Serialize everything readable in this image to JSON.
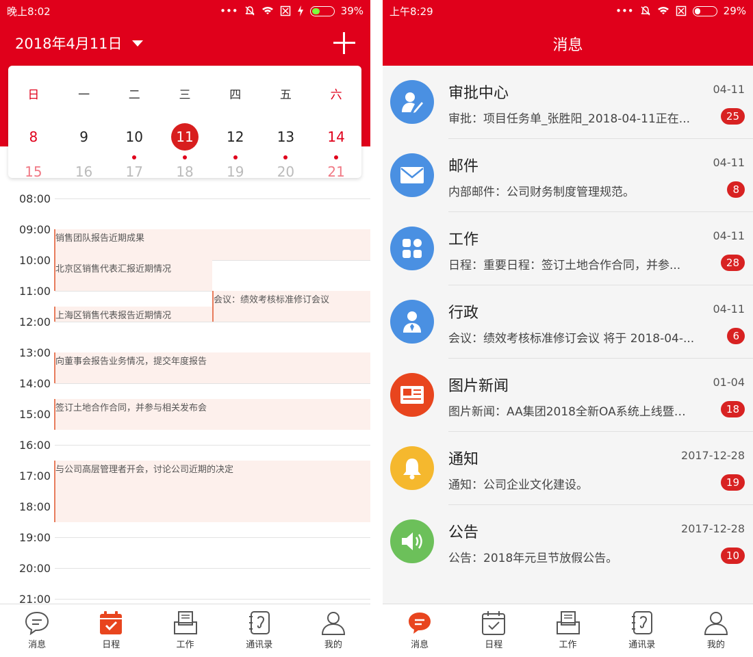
{
  "left": {
    "status": {
      "time": "晚上8:02",
      "battery": "39%",
      "battery_level": 0.39
    },
    "header": {
      "date": "2018年4月11日"
    },
    "weekdays": [
      "日",
      "一",
      "二",
      "三",
      "四",
      "五",
      "六"
    ],
    "dates": [
      "8",
      "9",
      "10",
      "11",
      "12",
      "13",
      "14"
    ],
    "next_dates": [
      "15",
      "16",
      "17",
      "18",
      "19",
      "20",
      "21"
    ],
    "selected_date": "11",
    "hours": [
      "08:00",
      "09:00",
      "10:00",
      "11:00",
      "12:00",
      "13:00",
      "14:00",
      "15:00",
      "16:00",
      "17:00",
      "18:00",
      "19:00",
      "20:00",
      "21:00"
    ],
    "events": [
      {
        "title": "销售团队报告近期成果",
        "start": "09:00",
        "end": "10:00",
        "column": "full"
      },
      {
        "title": "北京区销售代表汇报近期情况",
        "start": "10:00",
        "end": "11:00",
        "column": "left"
      },
      {
        "title": "会议：绩效考核标准修订会议",
        "start": "11:00",
        "end": "12:00",
        "column": "right"
      },
      {
        "title": "上海区销售代表报告近期情况",
        "start": "11:30",
        "end": "12:00",
        "column": "left"
      },
      {
        "title": "向董事会报告业务情况，提交年度报告",
        "start": "13:00",
        "end": "14:00",
        "column": "full"
      },
      {
        "title": "签订土地合作合同，并参与相关发布会",
        "start": "14:30",
        "end": "15:30",
        "column": "full"
      },
      {
        "title": "与公司高层管理者开会，讨论公司近期的决定",
        "start": "16:30",
        "end": "18:30",
        "column": "full"
      }
    ]
  },
  "right": {
    "status": {
      "time": "上午8:29",
      "battery": "29%",
      "battery_level": 0.29
    },
    "header": {
      "title": "消息"
    },
    "messages": [
      {
        "title": "审批中心",
        "date": "04-11",
        "subtitle": "审批：项目任务单_张胜阳_2018-04-11正在...",
        "badge": "25",
        "icon": "approval-icon",
        "color": "#4a90e2"
      },
      {
        "title": "邮件",
        "date": "04-11",
        "subtitle": "内部邮件：公司财务制度管理规范。",
        "badge": "8",
        "icon": "mail-icon",
        "color": "#4a90e2"
      },
      {
        "title": "工作",
        "date": "04-11",
        "subtitle": "日程：重要日程：签订土地合作合同，并参...",
        "badge": "28",
        "icon": "grid-icon",
        "color": "#4a90e2"
      },
      {
        "title": "行政",
        "date": "04-11",
        "subtitle": "会议：绩效考核标准修订会议 将于 2018-04-...",
        "badge": "6",
        "icon": "admin-person-icon",
        "color": "#4a90e2"
      },
      {
        "title": "图片新闻",
        "date": "01-04",
        "subtitle": "图片新闻：AA集团2018全新OA系统上线暨全...",
        "badge": "18",
        "icon": "newspaper-icon",
        "color": "#e8451e"
      },
      {
        "title": "通知",
        "date": "2017-12-28",
        "subtitle": "通知：公司企业文化建设。",
        "badge": "19",
        "icon": "bell-icon",
        "color": "#f5b82e"
      },
      {
        "title": "公告",
        "date": "2017-12-28",
        "subtitle": "公告：2018年元旦节放假公告。",
        "badge": "10",
        "icon": "speaker-icon",
        "color": "#6cc05a"
      }
    ]
  },
  "tabs": [
    "消息",
    "日程",
    "工作",
    "通讯录",
    "我的"
  ],
  "colors": {
    "brand": "#e0001b",
    "event_bg": "#fdf0ec",
    "event_border": "#e87c5c",
    "badge": "#d82222"
  }
}
